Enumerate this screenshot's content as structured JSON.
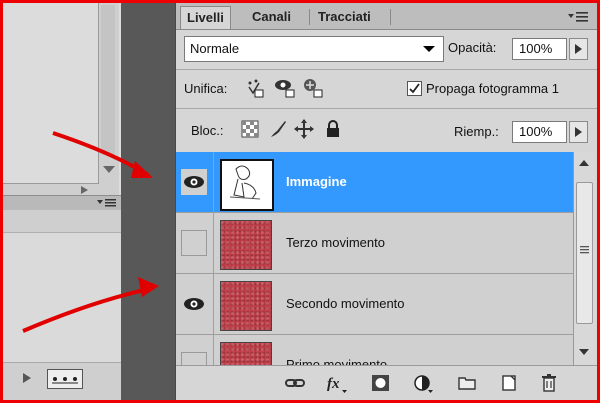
{
  "tabs": [
    "Livelli",
    "Canali",
    "Tracciati"
  ],
  "blend_mode": "Normale",
  "opacity": {
    "label": "Opacità:",
    "value": "100%"
  },
  "unify": {
    "label": "Unifica:"
  },
  "propagate": {
    "label": "Propaga fotogramma 1",
    "checked": true
  },
  "lock": {
    "label": "Bloc.:"
  },
  "fill": {
    "label": "Riemp.:",
    "value": "100%"
  },
  "layers": [
    {
      "name": "Immagine",
      "visible": true,
      "selected": true,
      "thumb": "image"
    },
    {
      "name": "Terzo movimento",
      "visible": false,
      "selected": false,
      "thumb": "red"
    },
    {
      "name": "Secondo movimento",
      "visible": true,
      "selected": false,
      "thumb": "red"
    },
    {
      "name": "Primo movimento",
      "visible": false,
      "selected": false,
      "thumb": "red"
    }
  ],
  "colors": {
    "selection": "#3399ff",
    "frame": "#e00000",
    "arrow": "#e00000"
  },
  "footer_icons": [
    "link-icon",
    "fx-icon",
    "mask-icon",
    "adjustment-icon",
    "group-folder-icon",
    "new-layer-icon",
    "trash-icon"
  ]
}
